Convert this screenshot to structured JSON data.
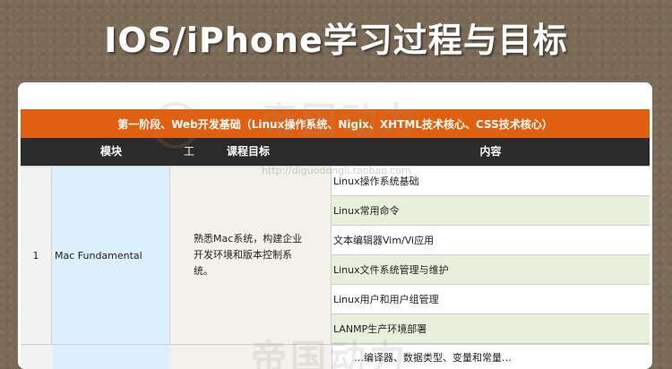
{
  "page_title": "IOS/iPhone学习过程与目标",
  "stage_banner": "第一阶段、Web开发基础（Linux操作系统、Nigix、XHTML技术核心、CSS技术核心）",
  "table": {
    "headers": {
      "module": "模块",
      "icon_glyph": "工",
      "goal": "课程目标",
      "content": "内容"
    },
    "rows": [
      {
        "number": "1",
        "module": "Mac Fundamental",
        "goal": "熟悉Mac系统，构建企业开发环境和版本控制系统。",
        "items": [
          "Linux操作系统基础",
          "Linux常用命令",
          "文本编辑器Vim/Vi应用",
          "Linux文件系统管理与维护",
          "Linux用户和用户组管理",
          "LANMP生产环境部署"
        ]
      }
    ],
    "next_row_partial_text": "…编译器、数据类型、变量和常量…"
  },
  "watermark": {
    "text": "帝国动力",
    "url": "http://diguodongli.taobao.com"
  },
  "colors": {
    "banner": "#e0600f",
    "header": "#2b2b2b",
    "module_bg": "#dcefff",
    "goal_bg": "#f4f0ea",
    "alt_row": "#e8f0dc"
  }
}
